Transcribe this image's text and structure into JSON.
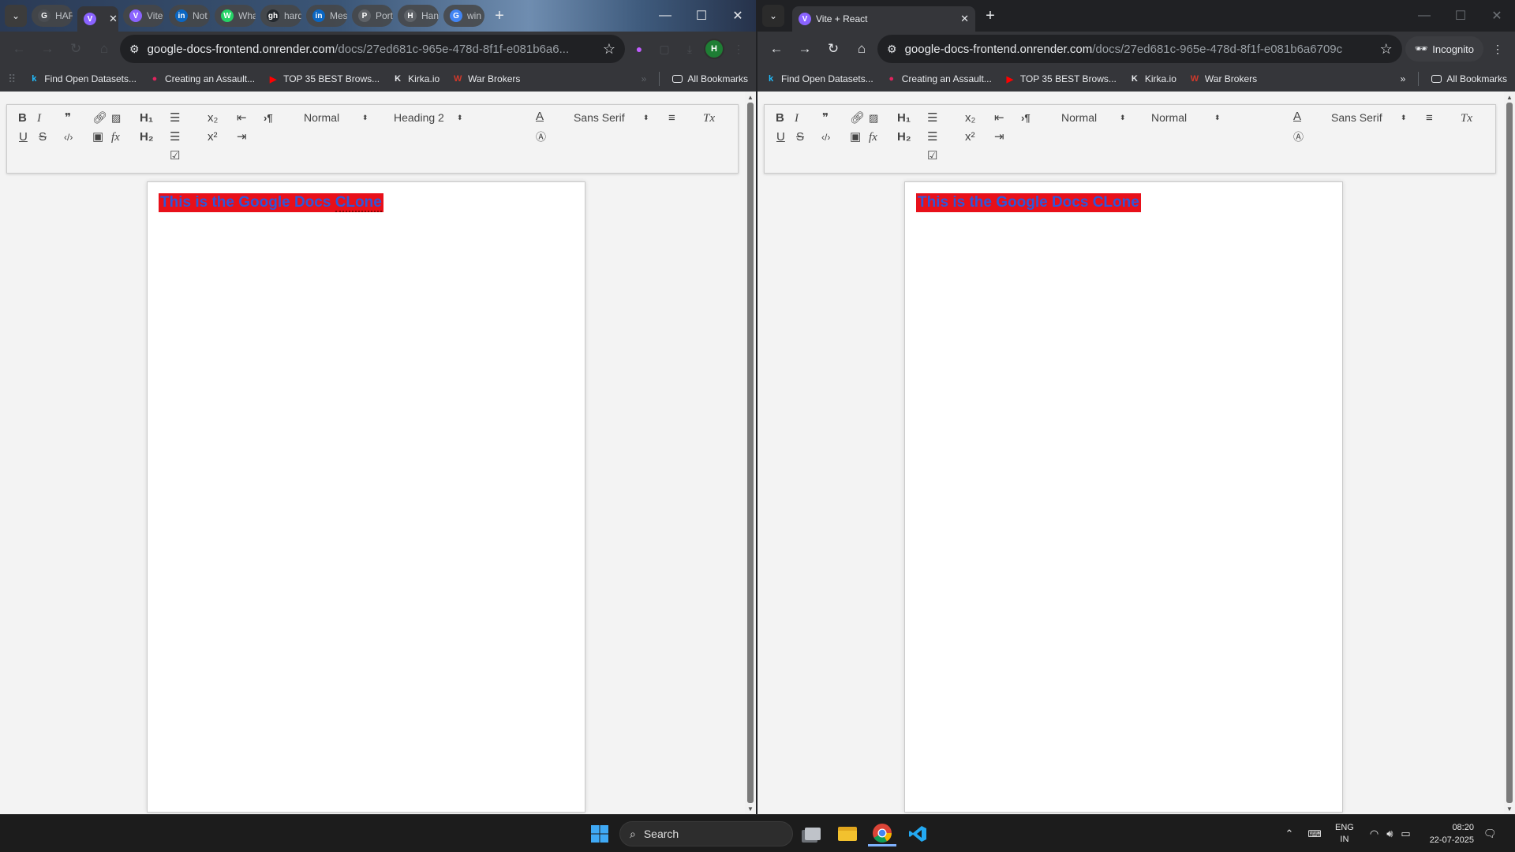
{
  "left_window": {
    "tabs": [
      {
        "label": "HAF",
        "fav": "G",
        "fav_color": "#4a4d52"
      },
      {
        "label": "",
        "fav": "V",
        "fav_color": "#8a63ff",
        "active": true
      },
      {
        "label": "Vite",
        "fav": "V",
        "fav_color": "#8a63ff"
      },
      {
        "label": "Not",
        "fav": "in",
        "fav_color": "#0a66c2"
      },
      {
        "label": "Wha",
        "fav": "W",
        "fav_color": "#25d366"
      },
      {
        "label": "hard",
        "fav": "gh",
        "fav_color": "#24292e"
      },
      {
        "label": "Mes",
        "fav": "in",
        "fav_color": "#0a66c2"
      },
      {
        "label": "Port",
        "fav": "P",
        "fav_color": "#5f6368"
      },
      {
        "label": "Han",
        "fav": "H",
        "fav_color": "#5f6368"
      },
      {
        "label": "win",
        "fav": "G",
        "fav_color": "#4285f4"
      }
    ],
    "url_host": "google-docs-frontend.onrender.com",
    "url_path": "/docs/27ed681c-965e-478d-8f1f-e081b6a6...",
    "avatar_letter": "H",
    "bookmarks": [
      {
        "label": "Find Open Datasets...",
        "icon": "k",
        "color": "#20beff"
      },
      {
        "label": "Creating an Assault...",
        "icon": "●",
        "color": "#e0245e"
      },
      {
        "label": "TOP 35 BEST Brows...",
        "icon": "▶",
        "color": "#ff0000"
      },
      {
        "label": "Kirka.io",
        "icon": "K",
        "color": "#e8eaed"
      },
      {
        "label": "War Brokers",
        "icon": "W",
        "color": "#d0392b"
      }
    ],
    "all_bookmarks": "All Bookmarks",
    "header_select": "Normal",
    "heading_select": "Heading 2",
    "font_select": "Sans Serif",
    "doc_text_a": "This is the Google Docs ",
    "doc_text_b": "CLone"
  },
  "right_window": {
    "tab_title": "Vite + React",
    "url_host": "google-docs-frontend.onrender.com",
    "url_path": "/docs/27ed681c-965e-478d-8f1f-e081b6a6709c",
    "incognito": "Incognito",
    "bookmarks": [
      {
        "label": "Find Open Datasets...",
        "icon": "k",
        "color": "#20beff"
      },
      {
        "label": "Creating an Assault...",
        "icon": "●",
        "color": "#e0245e"
      },
      {
        "label": "TOP 35 BEST Brows...",
        "icon": "▶",
        "color": "#ff0000"
      },
      {
        "label": "Kirka.io",
        "icon": "K",
        "color": "#e8eaed"
      },
      {
        "label": "War Brokers",
        "icon": "W",
        "color": "#d0392b"
      }
    ],
    "all_bookmarks": "All Bookmarks",
    "header_select": "Normal",
    "heading_select": "Normal",
    "font_select": "Sans Serif",
    "doc_text": "This is the Google Docs CLone"
  },
  "editor_toolbar": {
    "bold": "B",
    "italic": "I",
    "quote": "❞",
    "link_icon": "link-icon",
    "image_icon": "image-icon",
    "h1": "H₁",
    "h2": "H₂",
    "sub": "x₂",
    "sup": "x²",
    "paragraph": "›¶",
    "underline": "U",
    "strike": "S",
    "code": "‹/›",
    "video": "▣",
    "formula": "fx",
    "clean": "Tx",
    "color_a": "A"
  },
  "taskbar": {
    "search": "Search",
    "lang": "ENG",
    "region": "IN",
    "time": "08:20",
    "date": "22-07-2025"
  },
  "colors": {
    "heading_bg": "#e8101a",
    "heading_fg": "#2f57d8"
  }
}
